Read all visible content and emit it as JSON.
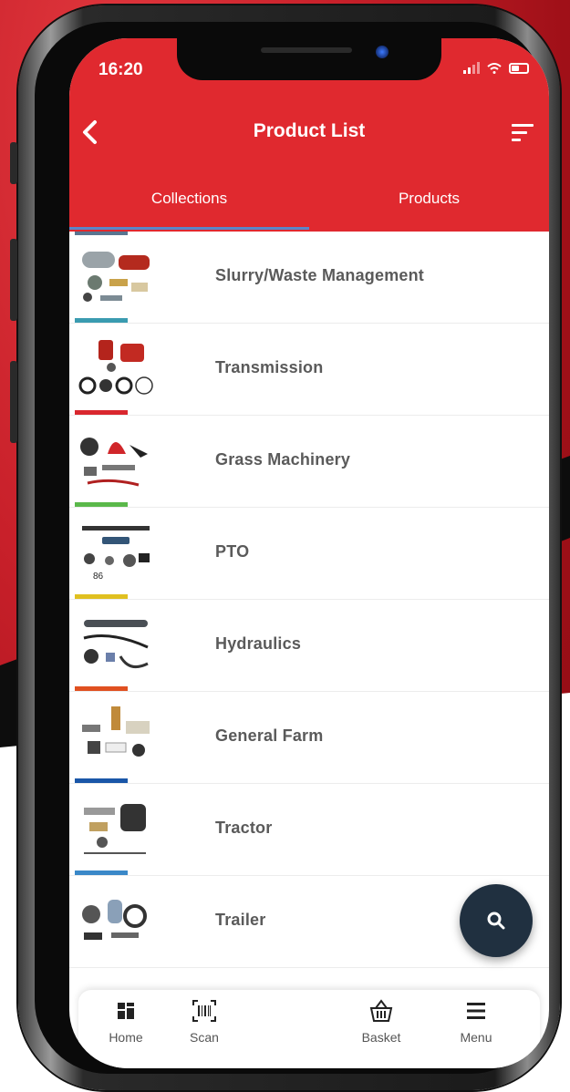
{
  "status_bar": {
    "time": "16:20"
  },
  "header": {
    "title": "Product List"
  },
  "tabs": [
    {
      "label": "Collections",
      "active": true
    },
    {
      "label": "Products",
      "active": false
    }
  ],
  "collections": [
    {
      "label": "Slurry/Waste Management",
      "color": "#3a9bb0"
    },
    {
      "label": "Transmission",
      "color": "#d9272e"
    },
    {
      "label": "Grass Machinery",
      "color": "#5ab84a"
    },
    {
      "label": "PTO",
      "color": "#e0c020"
    },
    {
      "label": "Hydraulics",
      "color": "#e05020"
    },
    {
      "label": "General Farm",
      "color": "#1a56a8"
    },
    {
      "label": "Tractor",
      "color": "#3a88c8"
    },
    {
      "label": "Trailer",
      "color": "#888888"
    }
  ],
  "fab": {
    "icon": "search-icon"
  },
  "bottom_nav": [
    {
      "label": "Home",
      "icon": "home-grid-icon"
    },
    {
      "label": "Scan",
      "icon": "barcode-scan-icon"
    },
    {
      "label": "Basket",
      "icon": "basket-icon"
    },
    {
      "label": "Menu",
      "icon": "hamburger-menu-icon"
    }
  ],
  "colors": {
    "brand_red": "#e0292f",
    "fab_dark": "#203040",
    "tab_indicator": "#5b86c9"
  }
}
